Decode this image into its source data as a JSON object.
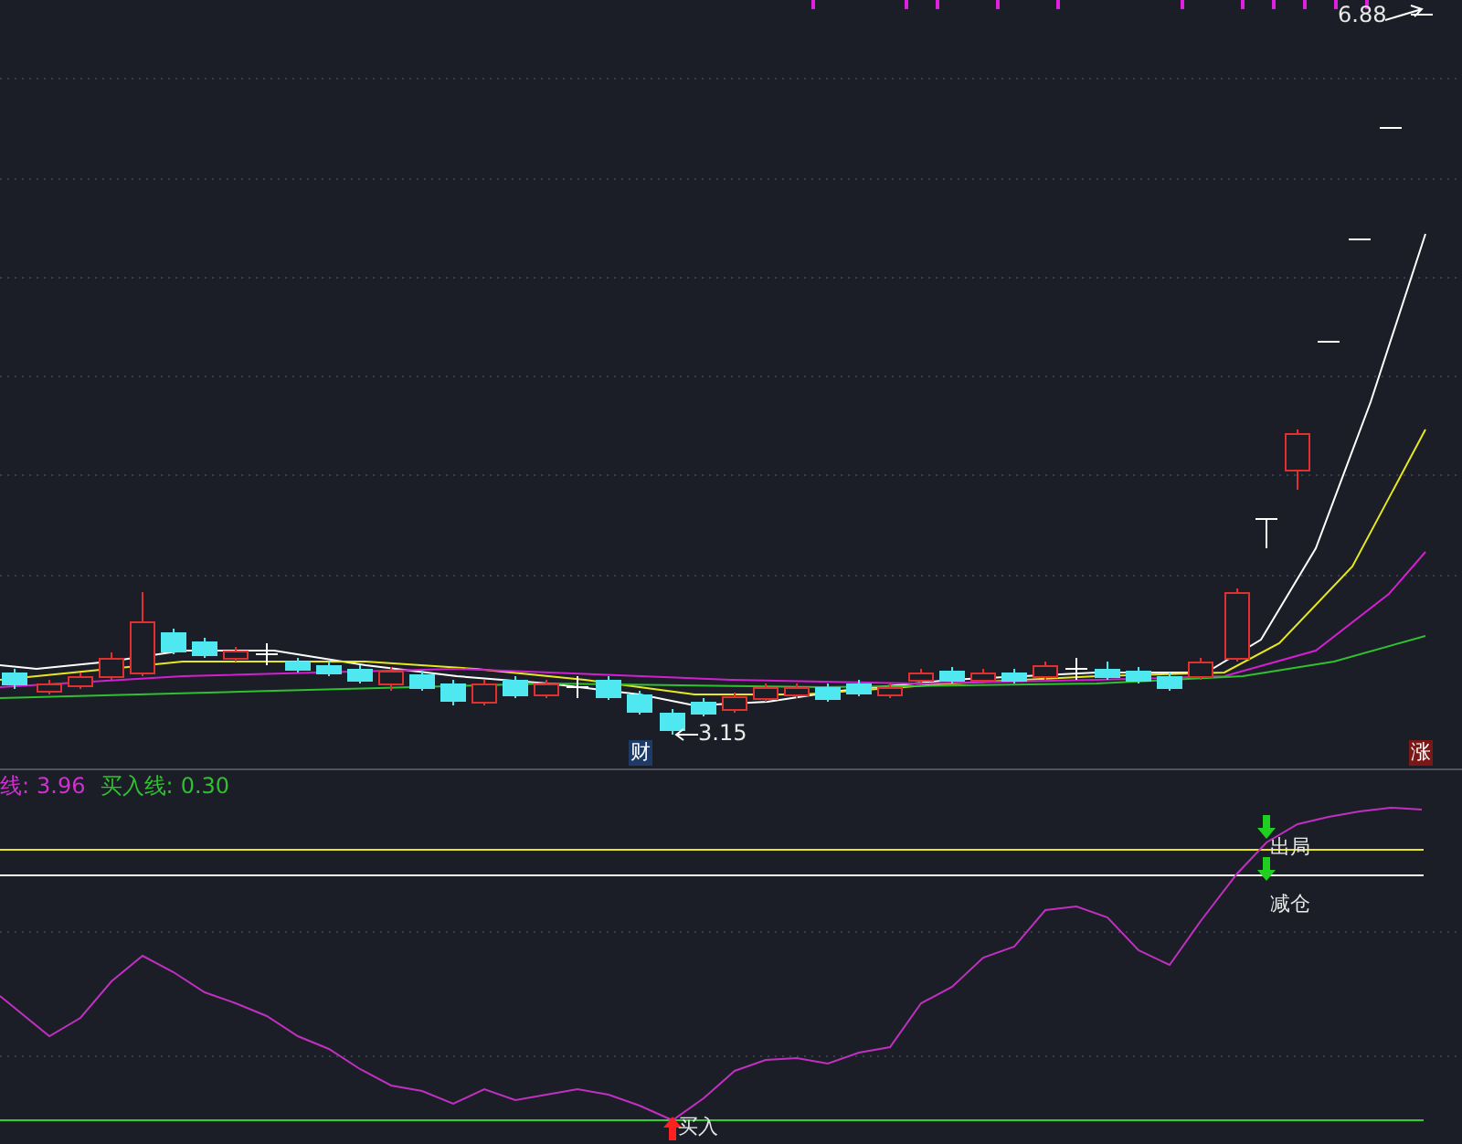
{
  "main_chart": {
    "high_label": "6.88",
    "low_label": "3.15",
    "badges": [
      {
        "text": "财",
        "kind": "finance"
      },
      {
        "text": "涨",
        "kind": "rise"
      }
    ]
  },
  "indicator": {
    "legend": [
      {
        "label": "线:",
        "value": "3.96",
        "kind": "sell"
      },
      {
        "label": "买入线:",
        "value": "0.30",
        "kind": "buy"
      }
    ],
    "signals": [
      {
        "text": "出局",
        "kind": "exit"
      },
      {
        "text": "减仓",
        "kind": "reduce"
      },
      {
        "text": "买入",
        "kind": "buy"
      }
    ]
  }
}
